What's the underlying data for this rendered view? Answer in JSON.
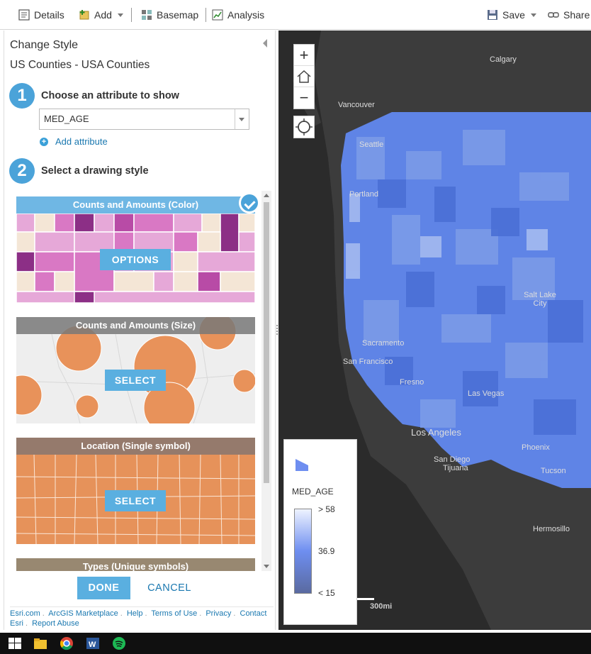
{
  "toolbar": {
    "details": "Details",
    "add": "Add",
    "basemap": "Basemap",
    "analysis": "Analysis",
    "save": "Save",
    "share": "Share"
  },
  "panel": {
    "title": "Change Style",
    "layer": "US Counties - USA Counties",
    "step1_num": "1",
    "step1_label": "Choose an attribute to show",
    "attribute_value": "MED_AGE",
    "add_attribute": "Add attribute",
    "step2_num": "2",
    "step2_label": "Select a drawing style",
    "styles": [
      {
        "title": "Counts and Amounts (Color)",
        "button": "OPTIONS",
        "selected": true
      },
      {
        "title": "Counts and Amounts (Size)",
        "button": "SELECT",
        "selected": false
      },
      {
        "title": "Location (Single symbol)",
        "button": "SELECT",
        "selected": false
      },
      {
        "title": "Types (Unique symbols)",
        "button": "",
        "selected": false
      }
    ],
    "done": "DONE",
    "cancel": "CANCEL"
  },
  "footer": {
    "links": [
      "Esri.com",
      "ArcGIS Marketplace",
      "Help",
      "Terms of Use",
      "Privacy",
      "Contact Esri",
      "Report Abuse"
    ]
  },
  "map": {
    "zoom_in": "+",
    "zoom_out": "−",
    "labels": [
      "Calgary",
      "Vancouver",
      "Seattle",
      "Portland",
      "Salt Lake City",
      "Sacramento",
      "San Francisco",
      "Fresno",
      "Las Vegas",
      "Los Angeles",
      "San Diego",
      "Tijuana",
      "Phoenix",
      "Tucson",
      "Hermosillo"
    ],
    "legend": {
      "field": "MED_AGE",
      "high": "> 58",
      "mid": "36.9",
      "low": "< 15"
    },
    "scale": "300mi"
  },
  "colors": {
    "accent": "#4ba3d9",
    "link": "#1a78b0",
    "map_bg": "#2b2b2b",
    "county_blue": "#5f84e6"
  }
}
